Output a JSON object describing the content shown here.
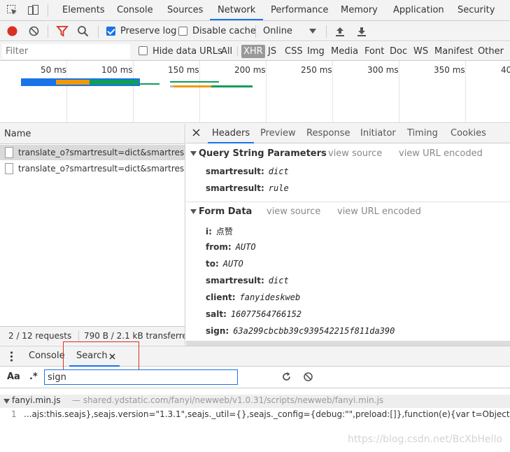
{
  "top_tabs": [
    "Elements",
    "Console",
    "Sources",
    "Network",
    "Performance",
    "Memory",
    "Application",
    "Security"
  ],
  "active_top_tab": "Network",
  "toolbar": {
    "preserve_log": "Preserve log",
    "disable_cache": "Disable cache",
    "throttle": "Online"
  },
  "filterbar": {
    "filter_placeholder": "Filter",
    "hide_data_urls": "Hide data URLs",
    "types": [
      "All",
      "XHR",
      "JS",
      "CSS",
      "Img",
      "Media",
      "Font",
      "Doc",
      "WS",
      "Manifest",
      "Other"
    ],
    "active_type": "XHR"
  },
  "overview": {
    "ticks": [
      "50 ms",
      "100 ms",
      "150 ms",
      "200 ms",
      "250 ms",
      "300 ms",
      "350 ms",
      "40"
    ]
  },
  "request_list": {
    "header": "Name",
    "rows": [
      "translate_o?smartresult=dict&smartresult=rule",
      "translate_o?smartresult=dict&smartresult=rule"
    ],
    "status_requests": "2 / 12 requests",
    "status_transferred": "790 B / 2.1 kB transferred"
  },
  "detail_tabs": [
    "Headers",
    "Preview",
    "Response",
    "Initiator",
    "Timing",
    "Cookies"
  ],
  "active_detail_tab": "Headers",
  "query_string": {
    "title": "Query String Parameters",
    "view_source": "view source",
    "view_url_encoded": "view URL encoded",
    "params": [
      {
        "key": "smartresult:",
        "value": "dict"
      },
      {
        "key": "smartresult:",
        "value": "rule"
      }
    ]
  },
  "form_data": {
    "title": "Form Data",
    "view_source": "view source",
    "view_url_encoded": "view URL encoded",
    "params": [
      {
        "key": "i:",
        "value": "点赞"
      },
      {
        "key": "from:",
        "value": "AUTO"
      },
      {
        "key": "to:",
        "value": "AUTO"
      },
      {
        "key": "smartresult:",
        "value": "dict"
      },
      {
        "key": "client:",
        "value": "fanyideskweb"
      },
      {
        "key": "salt:",
        "value": "16077564766152"
      },
      {
        "key": "sign:",
        "value": "63a299cbcbb39c939542215f811da390"
      }
    ]
  },
  "drawer": {
    "tabs": [
      "Console",
      "Search"
    ],
    "active_tab": "Search",
    "case_label": "Aa",
    "regex_label": ".*",
    "search_value": "sign"
  },
  "results": {
    "file": "fanyi.min.js",
    "path": "— shared.ydstatic.com/fanyi/newweb/v1.0.31/scripts/newweb/fanyi.min.js",
    "line_no": "1",
    "line_text": "...ajs:this.seajs},seajs.version=\"1.3.1\",seajs._util={},seajs._config={debug:\"\",preload:[]},function(e){var t=Object.prototype.toString"
  },
  "watermark": "https://blog.csdn.net/BcXbHello",
  "colors": {
    "accent": "#1a73e8",
    "record_red": "#d93025",
    "highlight_box": "#d93025"
  }
}
